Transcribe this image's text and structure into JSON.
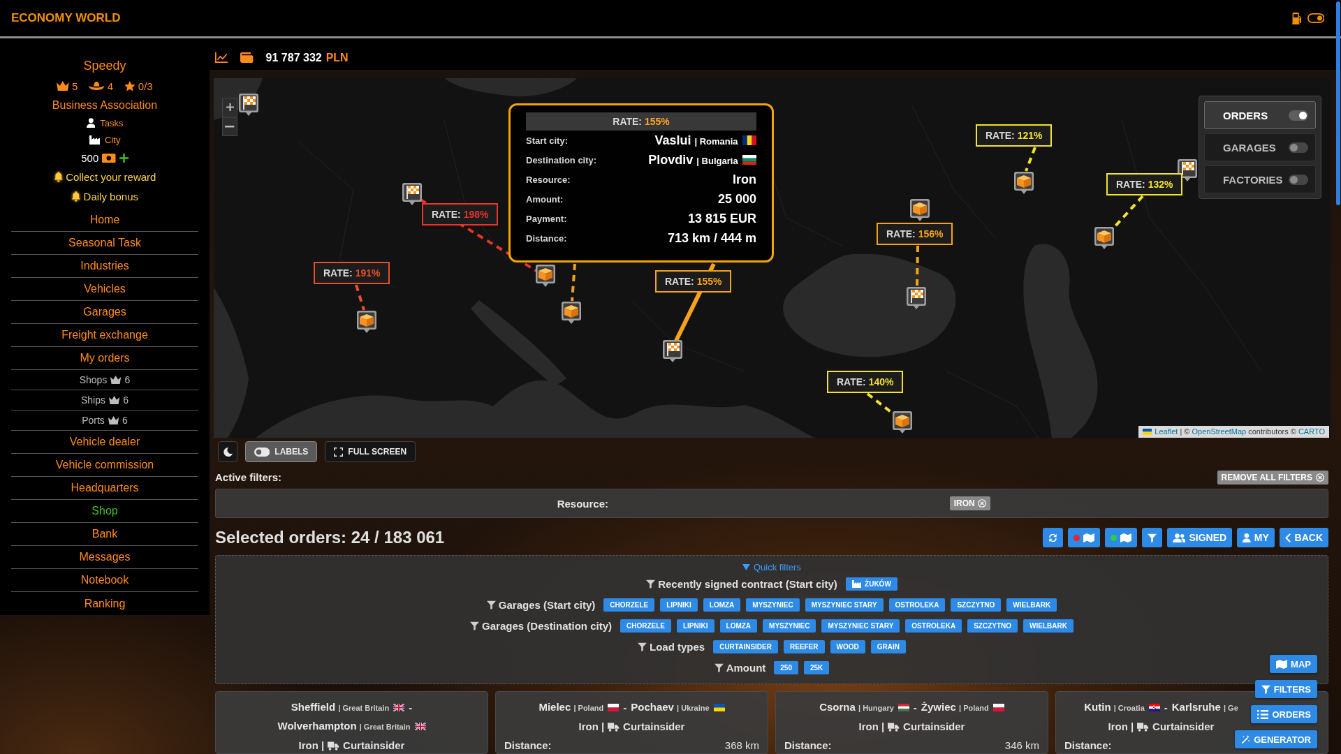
{
  "app": {
    "brand": "ECONOMY WORLD"
  },
  "profile": {
    "name": "Speedy",
    "stats": [
      {
        "kind": "crown",
        "value": "5"
      },
      {
        "kind": "hat",
        "value": "4"
      },
      {
        "kind": "star",
        "value": "0/3"
      }
    ],
    "association": "Business Association",
    "links": [
      {
        "kind": "person",
        "label": "Tasks"
      },
      {
        "kind": "factory",
        "label": "City"
      }
    ],
    "cash": "500",
    "notices": [
      "Collect your reward",
      "Daily bonus"
    ]
  },
  "menu": [
    {
      "label": "Home",
      "kind": "main"
    },
    {
      "label": "Seasonal Task",
      "kind": "main"
    },
    {
      "label": "Industries",
      "kind": "main"
    },
    {
      "label": "Vehicles",
      "kind": "main"
    },
    {
      "label": "Garages",
      "kind": "main"
    },
    {
      "label": "Freight exchange",
      "kind": "main"
    },
    {
      "label": "My orders",
      "kind": "main"
    },
    {
      "label": "Shops",
      "kind": "premium",
      "count": "6"
    },
    {
      "label": "Ships",
      "kind": "premium",
      "count": "6"
    },
    {
      "label": "Ports",
      "kind": "premium",
      "count": "6"
    },
    {
      "label": "Vehicle dealer",
      "kind": "main"
    },
    {
      "label": "Vehicle commission",
      "kind": "main"
    },
    {
      "label": "Headquarters",
      "kind": "main"
    },
    {
      "label": "Shop",
      "kind": "store"
    },
    {
      "label": "Bank",
      "kind": "main"
    },
    {
      "label": "Messages",
      "kind": "main"
    },
    {
      "label": "Notebook",
      "kind": "main"
    },
    {
      "label": "Ranking",
      "kind": "main"
    }
  ],
  "balance": {
    "amount": "91 787 332",
    "currency": "PLN"
  },
  "map": {
    "markers": [
      {
        "kind": "flag"
      },
      {
        "kind": "flag"
      },
      {
        "kind": "box"
      },
      {
        "kind": "box"
      },
      {
        "kind": "box"
      },
      {
        "kind": "flag"
      },
      {
        "kind": "box"
      },
      {
        "kind": "box"
      },
      {
        "kind": "flag"
      },
      {
        "kind": "flag"
      },
      {
        "kind": "box"
      },
      {
        "kind": "box"
      }
    ],
    "routes": [
      {
        "rate_label": "RATE:",
        "rate": "198%",
        "color": "#e8342a",
        "kind": "dashed"
      },
      {
        "rate_label": "RATE:",
        "rate": "191%",
        "color": "#e8502c",
        "kind": "dashed"
      },
      {
        "color": "#f0a020",
        "kind": "dashed"
      },
      {
        "rate_label": "RATE:",
        "rate": "155%",
        "color": "#f7a21b",
        "kind": "solid"
      },
      {
        "rate_label": "RATE:",
        "rate": "121%",
        "color": "#f2e22c",
        "kind": "dashed"
      },
      {
        "rate_label": "RATE:",
        "rate": "156%",
        "color": "#f7a21b",
        "kind": "dashed"
      },
      {
        "rate_label": "RATE:",
        "rate": "132%",
        "color": "#f2e22c",
        "kind": "dashed"
      },
      {
        "rate_label": "RATE:",
        "rate": "140%",
        "color": "#f2e22c",
        "kind": "dashed"
      }
    ],
    "tooltip": {
      "rate_label": "RATE:",
      "rate": "155%",
      "rows": [
        {
          "kind": "place",
          "label": "Start city:",
          "city": "Vaslui",
          "separator": "|",
          "country": "Romania",
          "flag": {
            "kind": "ro"
          }
        },
        {
          "kind": "place",
          "label": "Destination city:",
          "city": "Plovdiv",
          "separator": "|",
          "country": "Bulgaria",
          "flag": {
            "kind": "bg"
          }
        },
        {
          "kind": "value",
          "label": "Resource:",
          "value": "Iron"
        },
        {
          "kind": "value",
          "label": "Amount:",
          "value": "25 000"
        },
        {
          "kind": "value",
          "label": "Payment:",
          "value": "13 815 EUR"
        },
        {
          "kind": "value",
          "label": "Distance:",
          "value": "713 km / 444 m"
        }
      ]
    },
    "layers": [
      {
        "label": "ORDERS",
        "on": true
      },
      {
        "label": "GARAGES",
        "on": false
      },
      {
        "label": "FACTORIES",
        "on": false
      }
    ],
    "attribution": [
      {
        "text": "Leaflet",
        "link": true
      },
      {
        "text": "| ©",
        "link": false
      },
      {
        "text": "OpenStreetMap",
        "link": true
      },
      {
        "text": "contributors ©",
        "link": false
      },
      {
        "text": "CARTO",
        "link": true
      }
    ]
  },
  "map_tools": [
    {
      "kind": "theme",
      "on": false
    },
    {
      "kind": "labels",
      "label": "LABELS",
      "on": true
    },
    {
      "kind": "fullscreen",
      "label": "FULL SCREEN",
      "on": false
    }
  ],
  "active_filters": {
    "title": "Active filters:",
    "clear_label": "REMOVE ALL FILTERS",
    "items": [
      {
        "label": "Resource:",
        "value": "IRON"
      }
    ]
  },
  "orders": {
    "title": "Selected orders: 24 / 183 061",
    "actions": [
      {
        "kind": "refresh"
      },
      {
        "kind": "map",
        "color": "#e8262a"
      },
      {
        "kind": "map",
        "color": "#2ecc40"
      },
      {
        "kind": "filter"
      },
      {
        "kind": "signed",
        "label": "SIGNED"
      },
      {
        "kind": "my",
        "label": "MY"
      },
      {
        "kind": "back",
        "label": "BACK"
      }
    ]
  },
  "quick_filters": {
    "title": "Quick filters",
    "expanded": true,
    "groups": [
      {
        "label": "Recently signed contract (Start city)",
        "chips": [
          {
            "label": "ŻUKÓW",
            "kind": "factory"
          }
        ]
      },
      {
        "label": "Garages (Start city)",
        "chips": [
          {
            "label": "CHORZELE"
          },
          {
            "label": "LIPNIKI"
          },
          {
            "label": "LOMZA"
          },
          {
            "label": "MYSZYNIEC"
          },
          {
            "label": "MYSZYNIEC STARY"
          },
          {
            "label": "OSTROLEKA"
          },
          {
            "label": "SZCZYTNO"
          },
          {
            "label": "WIELBARK"
          }
        ]
      },
      {
        "label": "Garages (Destination city)",
        "chips": [
          {
            "label": "CHORZELE"
          },
          {
            "label": "LIPNIKI"
          },
          {
            "label": "LOMZA"
          },
          {
            "label": "MYSZYNIEC"
          },
          {
            "label": "MYSZYNIEC STARY"
          },
          {
            "label": "OSTROLEKA"
          },
          {
            "label": "SZCZYTNO"
          },
          {
            "label": "WIELBARK"
          }
        ]
      },
      {
        "label": "Load types",
        "chips": [
          {
            "label": "CURTAINSIDER"
          },
          {
            "label": "REEFER"
          },
          {
            "label": "WOOD"
          },
          {
            "label": "GRAIN"
          }
        ]
      },
      {
        "label": "Amount",
        "chips": [
          {
            "label": "250"
          },
          {
            "label": "25K"
          }
        ]
      }
    ]
  },
  "order_cards": [
    {
      "from": {
        "city": "Sheffield",
        "separator": "|",
        "country": "Great Britain",
        "flag": {
          "kind": "gb"
        }
      },
      "dash": "-",
      "to": {
        "city": "Wolverhampton",
        "separator": "|",
        "country": "Great Britain",
        "flag": {
          "kind": "gb"
        }
      },
      "resource": "Iron",
      "separator": "|",
      "vehicle": "Curtainsider"
    },
    {
      "from": {
        "city": "Mielec",
        "separator": "|",
        "country": "Poland",
        "flag": {
          "kind": "pl"
        }
      },
      "dash": "-",
      "to": {
        "city": "Pochaev",
        "separator": "|",
        "country": "Ukraine",
        "flag": {
          "kind": "ua"
        }
      },
      "resource": "Iron",
      "separator": "|",
      "vehicle": "Curtainsider",
      "distance_label": "Distance:",
      "distance": "368 km"
    },
    {
      "from": {
        "city": "Csorna",
        "separator": "|",
        "country": "Hungary",
        "flag": {
          "kind": "hu"
        }
      },
      "dash": "-",
      "to": {
        "city": "Żywiec",
        "separator": "|",
        "country": "Poland",
        "flag": {
          "kind": "pl"
        }
      },
      "resource": "Iron",
      "separator": "|",
      "vehicle": "Curtainsider",
      "distance_label": "Distance:",
      "distance": "346 km"
    },
    {
      "from": {
        "city": "Kutin",
        "separator": "|",
        "country": "Croatia",
        "flag": {
          "kind": "hr"
        }
      },
      "dash": "-",
      "to": {
        "city": "Karlsruhe",
        "separator": "|",
        "country": "Ge"
      },
      "resource": "Iron",
      "separator": "|",
      "vehicle": "Curtainsider",
      "distance_label": "Distance:"
    }
  ],
  "dock": [
    {
      "kind": "map",
      "label": "MAP"
    },
    {
      "kind": "filter",
      "label": "FILTERS"
    },
    {
      "kind": "list",
      "label": "ORDERS"
    },
    {
      "kind": "wand",
      "label": "GENERATOR"
    }
  ]
}
